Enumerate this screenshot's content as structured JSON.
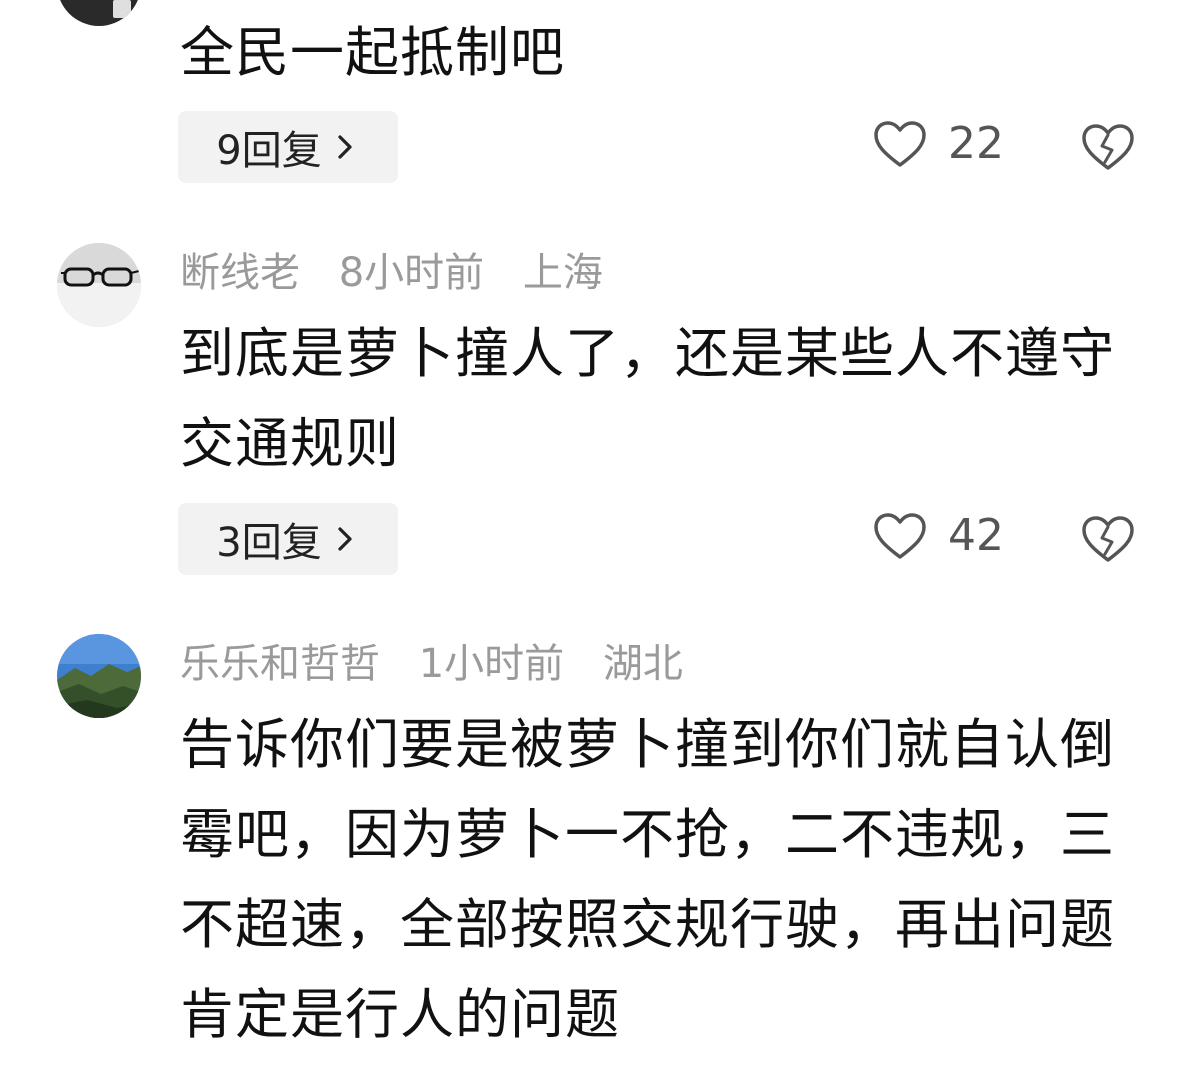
{
  "comments": [
    {
      "content": "全民一起抵制吧",
      "reply_label": "9回复",
      "likes": "22"
    },
    {
      "username": "断线老",
      "time": "8小时前",
      "location": "上海",
      "content": "到底是萝卜撞人了，还是某些人不遵守交通规则",
      "reply_label": "3回复",
      "likes": "42"
    },
    {
      "username": "乐乐和哲哲",
      "time": "1小时前",
      "location": "湖北",
      "content": "告诉你们要是被萝卜撞到你们就自认倒霉吧，因为萝卜一不抢，二不违规，三不超速，全部按照交规行驶，再出问题肯定是行人的问题"
    }
  ]
}
